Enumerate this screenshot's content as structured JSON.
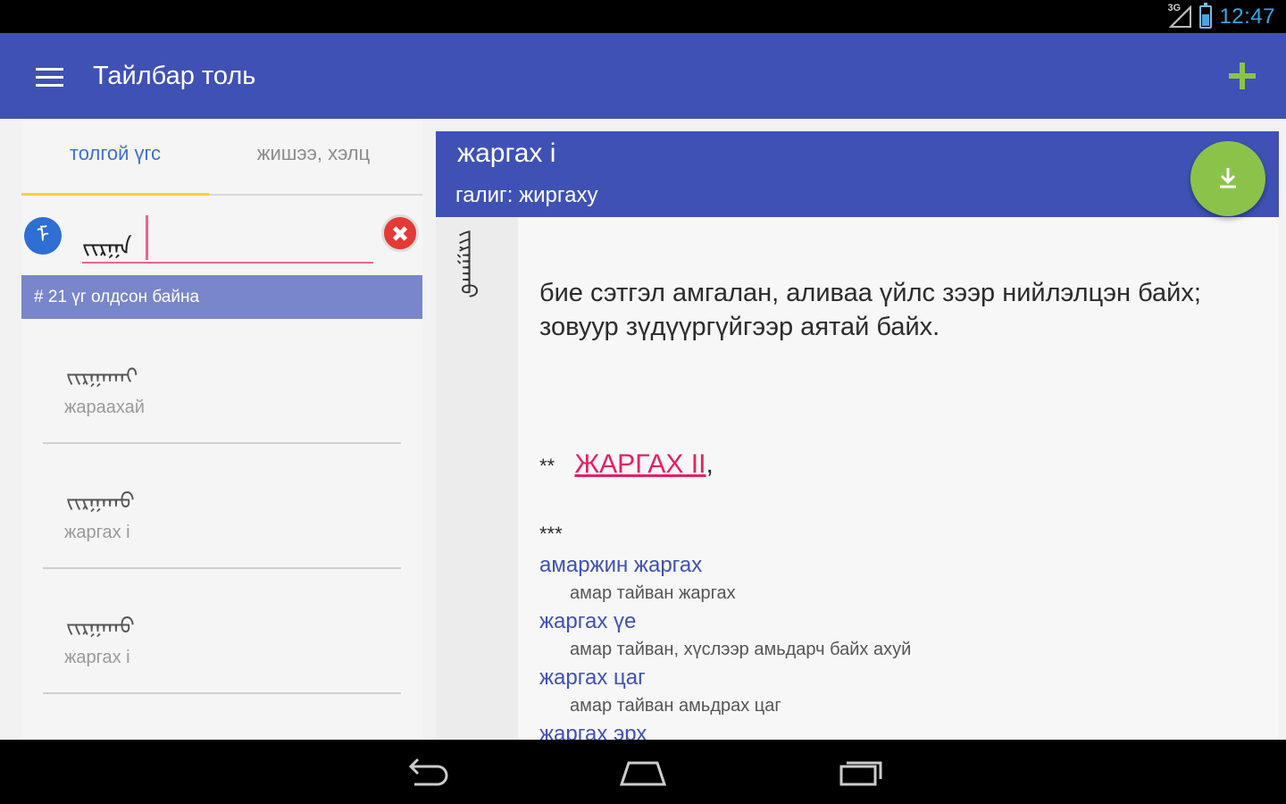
{
  "status_bar": {
    "network": "3G",
    "time": "12:47"
  },
  "app_bar": {
    "title": "Тайлбар толь",
    "menu_icon": "menu-icon",
    "add_icon": "plus-icon"
  },
  "tabs": [
    {
      "label": "толгой үгс",
      "active": true
    },
    {
      "label": "жишээ, хэлц",
      "active": false
    }
  ],
  "search": {
    "value": "ᠵᠢᠷᠭᠠ",
    "lang_icon_glyph": "ᠮ"
  },
  "result_banner": "# 21 үг олдсон байна",
  "results": [
    {
      "script": "ᠵᠢᠷᠭᠠᠬᠠᠢ",
      "word": "жараахай"
    },
    {
      "script": "ᠵᠢᠷᠭᠠᠬᠤ",
      "word": "жаргах i"
    },
    {
      "script": "ᠵᠢᠷᠭᠠᠬᠤ",
      "word": "жаргах i"
    }
  ],
  "entry": {
    "title": "жаргах i",
    "label": "галиг:  жиргаху",
    "vertical_script": "ᠵᠢᠷᠭᠠᠬᠤ",
    "definition_line1": "бие сэтгэл амгалан, аливаа үйлс зээр нийлэлцэн байх;",
    "definition_line2": "зовуур зүдүүргүйгээр аятай байх.",
    "see_also_stars": "**",
    "see_also_link": "ЖАРГАХ II",
    "see_also_suffix": ",",
    "phrases_marker": "***",
    "phrases": [
      {
        "term": "амаржин жаргах",
        "def": "амар тайван жаргах"
      },
      {
        "term": "жаргах үе",
        "def": "амар тайван, хүслээр амьдарч байх ахуй"
      },
      {
        "term": "жаргах цаг",
        "def": "амар тайван амьдрах цаг"
      },
      {
        "term": "жаргах эрх",
        "def": ""
      }
    ]
  },
  "colors": {
    "primary": "#3f51b5",
    "accent_green": "#8bc34a",
    "link_pink": "#e91e63",
    "tab_indicator": "#f4d23b",
    "banner": "#7986cb"
  }
}
